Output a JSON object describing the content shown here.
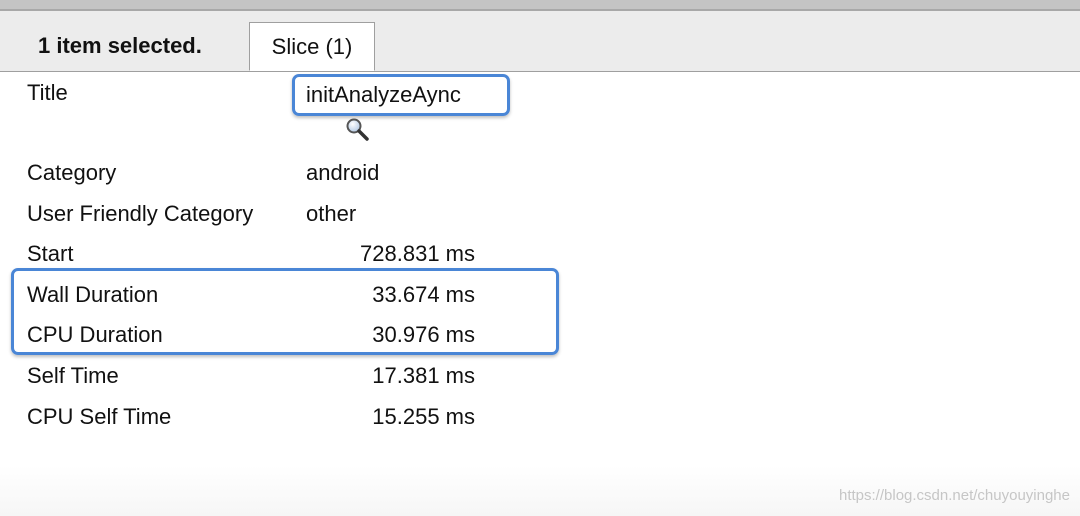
{
  "header": {
    "selection_label": "1 item selected.",
    "tab_label": "Slice (1)"
  },
  "details": {
    "title": {
      "label": "Title",
      "value": "initAnalyzeAync"
    },
    "category": {
      "label": "Category",
      "value": "android"
    },
    "user_friendly_category": {
      "label": "User Friendly Category",
      "value": "other"
    },
    "start": {
      "label": "Start",
      "value": "728.831 ms"
    },
    "wall_duration": {
      "label": "Wall Duration",
      "value": "33.674 ms"
    },
    "cpu_duration": {
      "label": "CPU Duration",
      "value": "30.976 ms"
    },
    "self_time": {
      "label": "Self Time",
      "value": "17.381 ms"
    },
    "cpu_self_time": {
      "label": "CPU Self Time",
      "value": "15.255 ms"
    }
  },
  "icons": {
    "search": "search-icon"
  },
  "colors": {
    "highlight": "#4a86d6"
  },
  "watermark": "https://blog.csdn.net/chuyouyinghe"
}
